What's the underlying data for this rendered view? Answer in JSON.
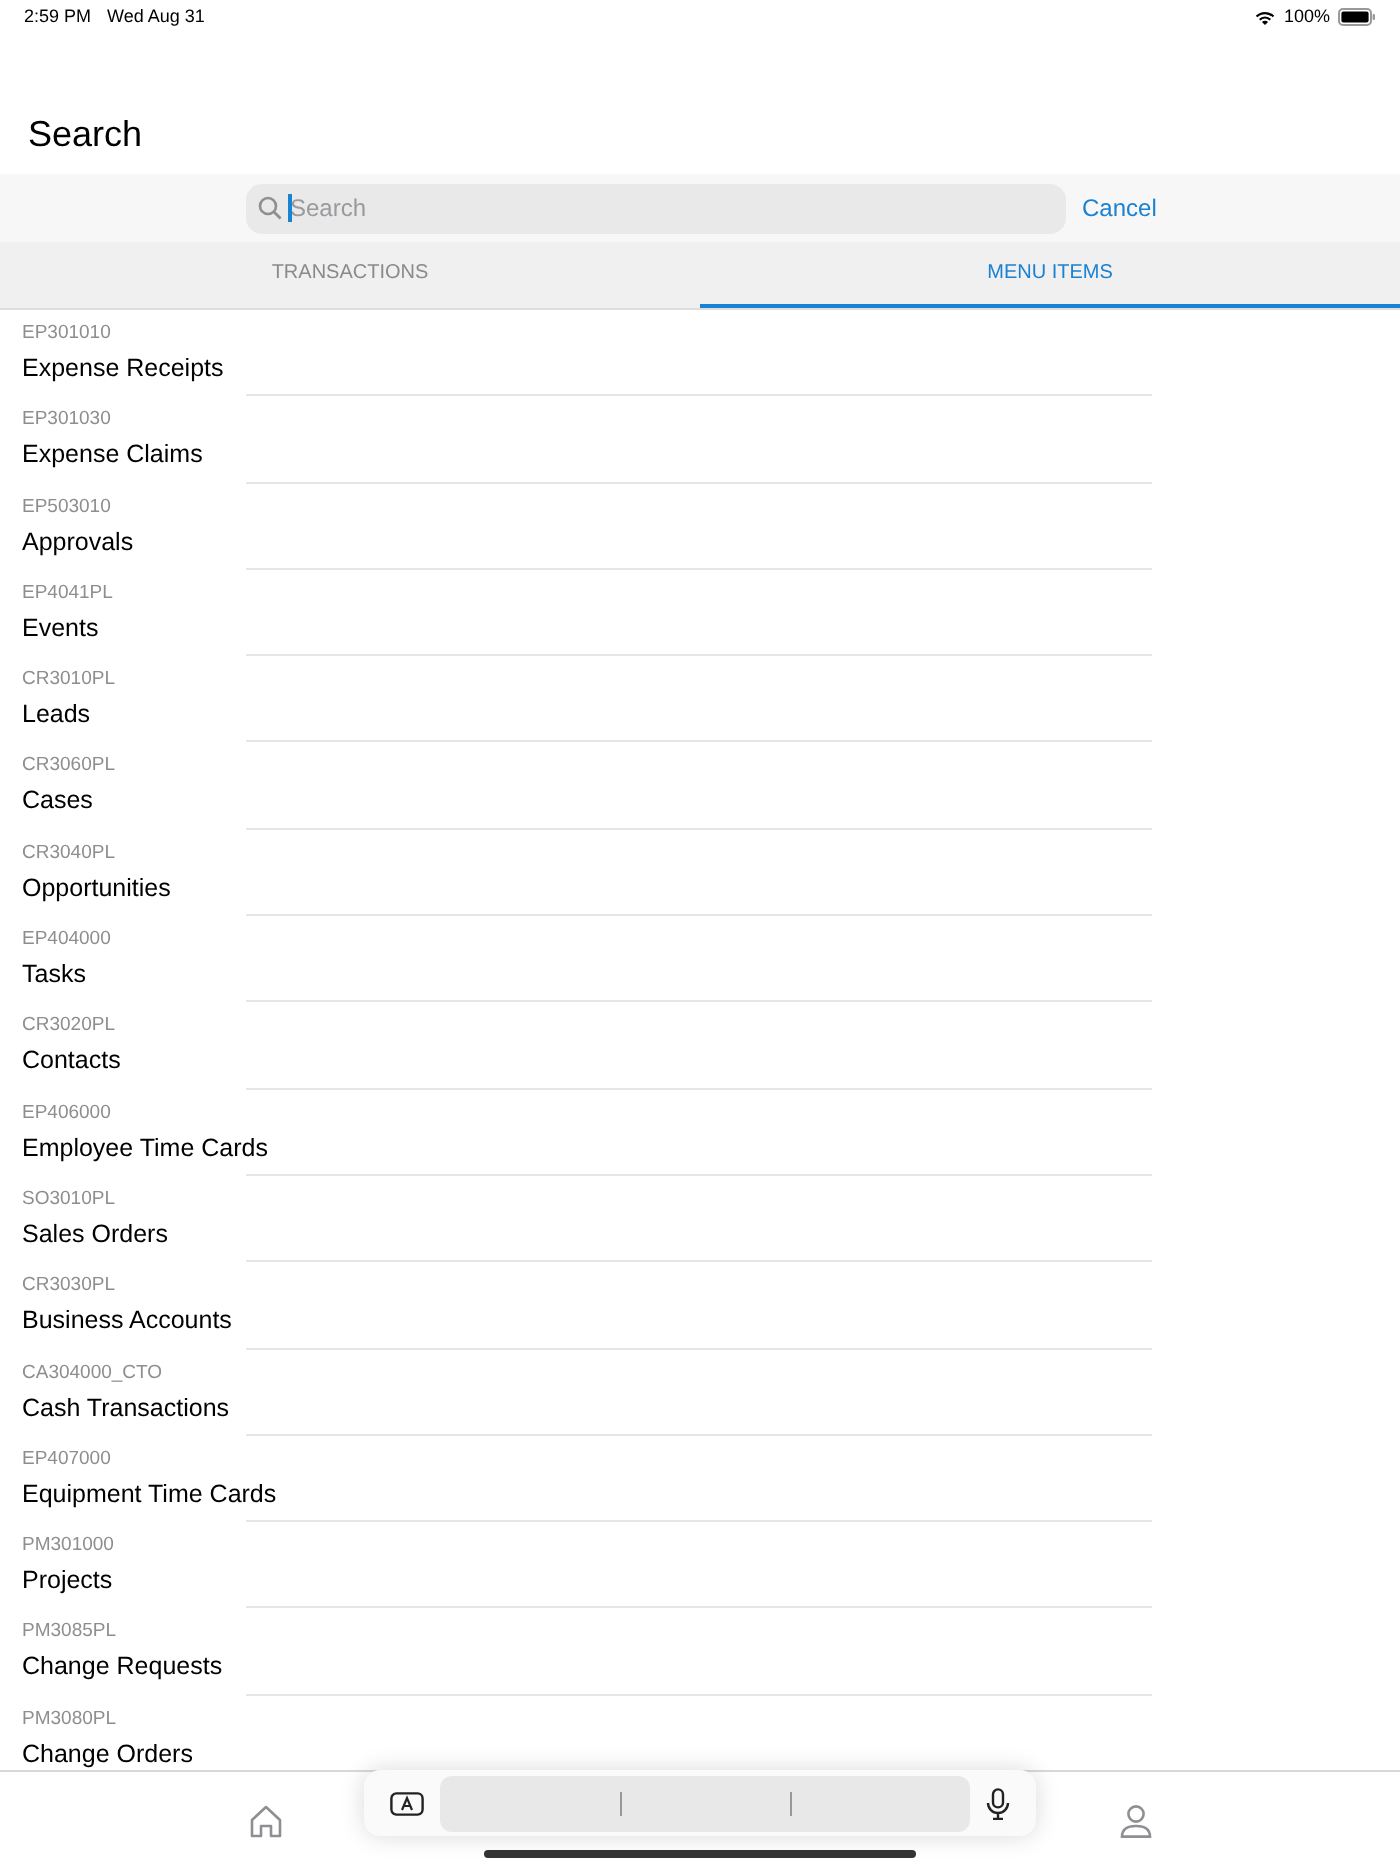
{
  "status_bar": {
    "time": "2:59 PM",
    "date": "Wed Aug 31",
    "battery": "100%"
  },
  "title": "Search",
  "search": {
    "placeholder": "Search",
    "cancel": "Cancel"
  },
  "tabs": [
    {
      "label": "TRANSACTIONS",
      "selected": false
    },
    {
      "label": "MENU ITEMS",
      "selected": true
    }
  ],
  "items": [
    {
      "code": "EP301010",
      "name": "Expense Receipts"
    },
    {
      "code": "EP301030",
      "name": "Expense Claims"
    },
    {
      "code": "EP503010",
      "name": "Approvals"
    },
    {
      "code": "EP4041PL",
      "name": "Events"
    },
    {
      "code": "CR3010PL",
      "name": "Leads"
    },
    {
      "code": "CR3060PL",
      "name": "Cases"
    },
    {
      "code": "CR3040PL",
      "name": "Opportunities"
    },
    {
      "code": "EP404000",
      "name": "Tasks"
    },
    {
      "code": "CR3020PL",
      "name": "Contacts"
    },
    {
      "code": "EP406000",
      "name": "Employee Time Cards"
    },
    {
      "code": "SO3010PL",
      "name": "Sales Orders"
    },
    {
      "code": "CR3030PL",
      "name": "Business Accounts"
    },
    {
      "code": "CA304000_CTO",
      "name": "Cash Transactions"
    },
    {
      "code": "EP407000",
      "name": "Equipment Time Cards"
    },
    {
      "code": "PM301000",
      "name": "Projects"
    },
    {
      "code": "PM3085PL",
      "name": "Change Requests"
    },
    {
      "code": "PM3080PL",
      "name": "Change Orders"
    }
  ]
}
